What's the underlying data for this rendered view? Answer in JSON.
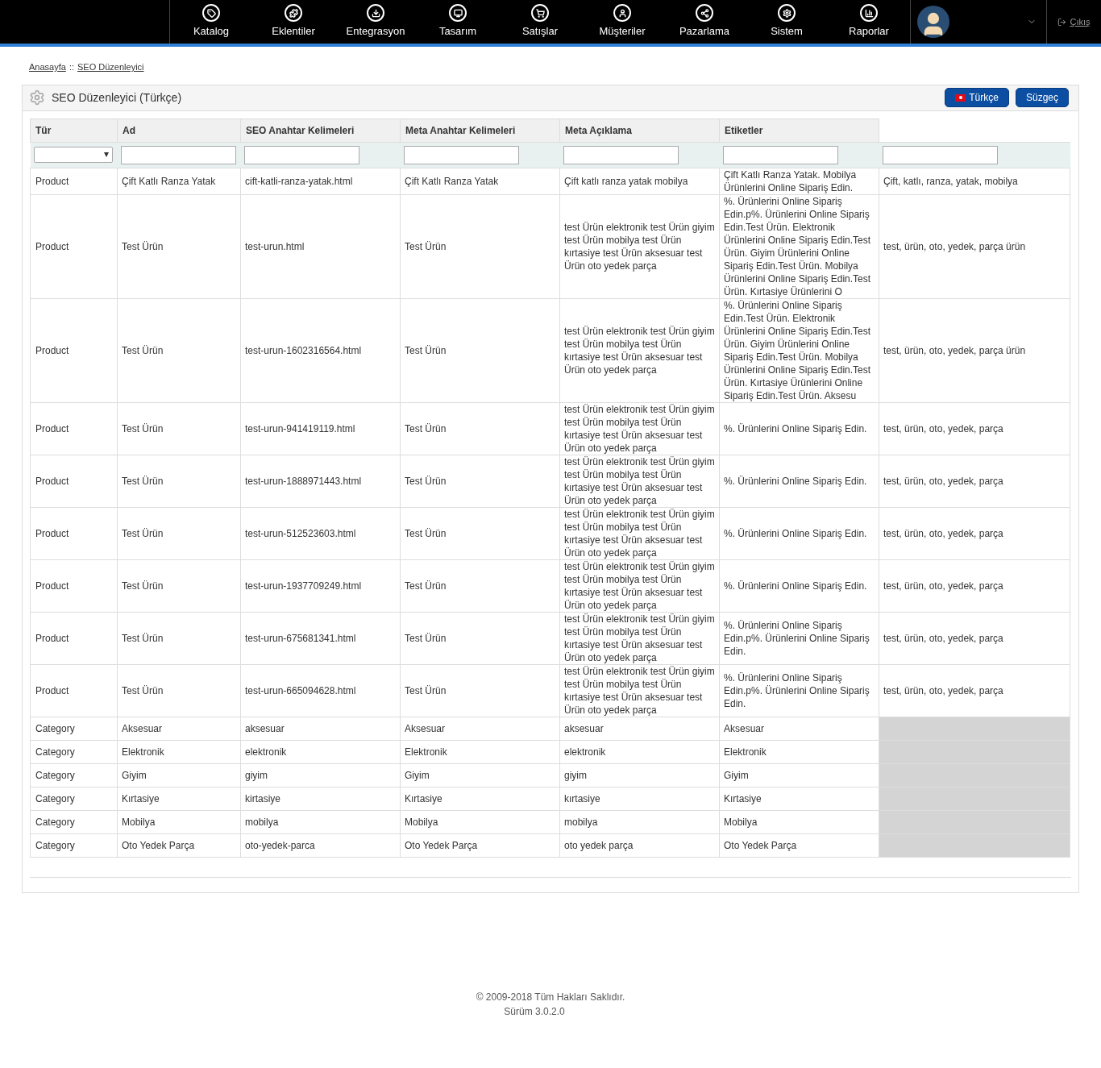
{
  "nav": [
    {
      "label": "Katalog"
    },
    {
      "label": "Eklentiler"
    },
    {
      "label": "Entegrasyon"
    },
    {
      "label": "Tasarım"
    },
    {
      "label": "Satışlar"
    },
    {
      "label": "Müşteriler"
    },
    {
      "label": "Pazarlama"
    },
    {
      "label": "Sistem"
    },
    {
      "label": "Raporlar"
    }
  ],
  "logout": "Çıkış",
  "breadcrumb": [
    {
      "label": "Anasayfa"
    },
    {
      "label": "SEO Düzenleyici"
    }
  ],
  "breadcrumb_separator": "::",
  "panel": {
    "title": "SEO Düzenleyici (Türkçe)",
    "buttons": [
      {
        "label": "Türkçe",
        "kind": "language"
      },
      {
        "label": "Süzgeç",
        "kind": "plain"
      }
    ]
  },
  "table": {
    "columns": [
      "Tür",
      "Ad",
      "SEO Anahtar Kelimeleri",
      "Meta Anahtar Kelimeleri",
      "Meta Açıklama",
      "Etiketler"
    ],
    "filters": [
      {
        "kind": "select"
      },
      {
        "kind": "text"
      },
      {
        "kind": "text"
      },
      {
        "kind": "text"
      },
      {
        "kind": "text"
      },
      {
        "kind": "text"
      },
      {
        "kind": "text"
      }
    ],
    "rows": [
      {
        "cells": [
          "Product",
          "Çift Katlı Ranza Yatak",
          "cift-katli-ranza-yatak.html",
          "Çift Katlı Ranza Yatak",
          "Çift katlı ranza yatak mobilya",
          "Çift Katlı Ranza Yatak. Mobilya Ürünlerini Online Sipariş Edin."
        ],
        "column_7": "Çift, katlı, ranza, yatak, mobilya"
      },
      {
        "cells": [
          "Product",
          "Test Ürün",
          "test-urun.html",
          "Test Ürün",
          "test Ürün elektronik test Ürün giyim test Ürün mobilya test Ürün kırtasiye test Ürün aksesuar test Ürün oto yedek parça",
          "%. Ürünlerini Online Sipariş Edin.p%. Ürünlerini Online Sipariş Edin.Test Ürün. Elektronik Ürünlerini Online Sipariş Edin.Test Ürün. Giyim Ürünlerini Online Sipariş Edin.Test Ürün. Mobilya Ürünlerini Online Sipariş Edin.Test Ürün. Kırtasiye Ürünlerini O"
        ],
        "column_7": "test, ürün, oto, yedek, parça ürün"
      },
      {
        "cells": [
          "Product",
          "Test Ürün",
          "test-urun-1602316564.html",
          "Test Ürün",
          "test Ürün elektronik test Ürün giyim test Ürün mobilya test Ürün kırtasiye test Ürün aksesuar test Ürün oto yedek parça",
          "%. Ürünlerini Online Sipariş Edin.Test Ürün. Elektronik Ürünlerini Online Sipariş Edin.Test Ürün. Giyim Ürünlerini Online Sipariş Edin.Test Ürün. Mobilya Ürünlerini Online Sipariş Edin.Test Ürün. Kırtasiye Ürünlerini Online Sipariş Edin.Test Ürün. Aksesu"
        ],
        "column_7": "test, ürün, oto, yedek, parça ürün"
      },
      {
        "cells": [
          "Product",
          "Test Ürün",
          "test-urun-941419119.html",
          "Test Ürün",
          "test Ürün elektronik test Ürün giyim test Ürün mobilya test Ürün kırtasiye test Ürün aksesuar test Ürün oto yedek parça",
          "%. Ürünlerini Online Sipariş Edin."
        ],
        "column_7": "test, ürün, oto, yedek, parça"
      },
      {
        "cells": [
          "Product",
          "Test Ürün",
          "test-urun-1888971443.html",
          "Test Ürün",
          "test Ürün elektronik test Ürün giyim test Ürün mobilya test Ürün kırtasiye test Ürün aksesuar test Ürün oto yedek parça",
          "%. Ürünlerini Online Sipariş Edin."
        ],
        "column_7": "test, ürün, oto, yedek, parça"
      },
      {
        "cells": [
          "Product",
          "Test Ürün",
          "test-urun-512523603.html",
          "Test Ürün",
          "test Ürün elektronik test Ürün giyim test Ürün mobilya test Ürün kırtasiye test Ürün aksesuar test Ürün oto yedek parça",
          "%. Ürünlerini Online Sipariş Edin."
        ],
        "column_7": "test, ürün, oto, yedek, parça"
      },
      {
        "cells": [
          "Product",
          "Test Ürün",
          "test-urun-1937709249.html",
          "Test Ürün",
          "test Ürün elektronik test Ürün giyim test Ürün mobilya test Ürün kırtasiye test Ürün aksesuar test Ürün oto yedek parça",
          "%. Ürünlerini Online Sipariş Edin."
        ],
        "column_7": "test, ürün, oto, yedek, parça"
      },
      {
        "cells": [
          "Product",
          "Test Ürün",
          "test-urun-675681341.html",
          "Test Ürün",
          "test Ürün elektronik test Ürün giyim test Ürün mobilya test Ürün kırtasiye test Ürün aksesuar test Ürün oto yedek parça",
          "%. Ürünlerini Online Sipariş Edin.p%. Ürünlerini Online Sipariş Edin."
        ],
        "column_7": "test, ürün, oto, yedek, parça"
      },
      {
        "cells": [
          "Product",
          "Test Ürün",
          "test-urun-665094628.html",
          "Test Ürün",
          "test Ürün elektronik test Ürün giyim test Ürün mobilya test Ürün kırtasiye test Ürün aksesuar test Ürün oto yedek parça",
          "%. Ürünlerini Online Sipariş Edin.p%. Ürünlerini Online Sipariş Edin."
        ],
        "column_7": "test, ürün, oto, yedek, parça"
      },
      {
        "cells": [
          "Category",
          "Aksesuar",
          "aksesuar",
          "Aksesuar",
          "aksesuar",
          "Aksesuar"
        ]
      },
      {
        "cells": [
          "Category",
          "Elektronik",
          "elektronik",
          "Elektronik",
          "elektronik",
          "Elektronik"
        ]
      },
      {
        "cells": [
          "Category",
          "Giyim",
          "giyim",
          "Giyim",
          "giyim",
          "Giyim"
        ]
      },
      {
        "cells": [
          "Category",
          "Kırtasiye",
          "kirtasiye",
          "Kırtasiye",
          "kırtasiye",
          "Kırtasiye"
        ]
      },
      {
        "cells": [
          "Category",
          "Mobilya",
          "mobilya",
          "Mobilya",
          "mobilya",
          "Mobilya"
        ]
      },
      {
        "cells": [
          "Category",
          "Oto Yedek Parça",
          "oto-yedek-parca",
          "Oto Yedek Parça",
          "oto yedek parça",
          "Oto Yedek Parça"
        ]
      }
    ]
  },
  "footer": {
    "copyright": "© 2009-2018 Tüm Hakları Saklıdır.",
    "version": "Sürüm 3.0.2.0"
  }
}
